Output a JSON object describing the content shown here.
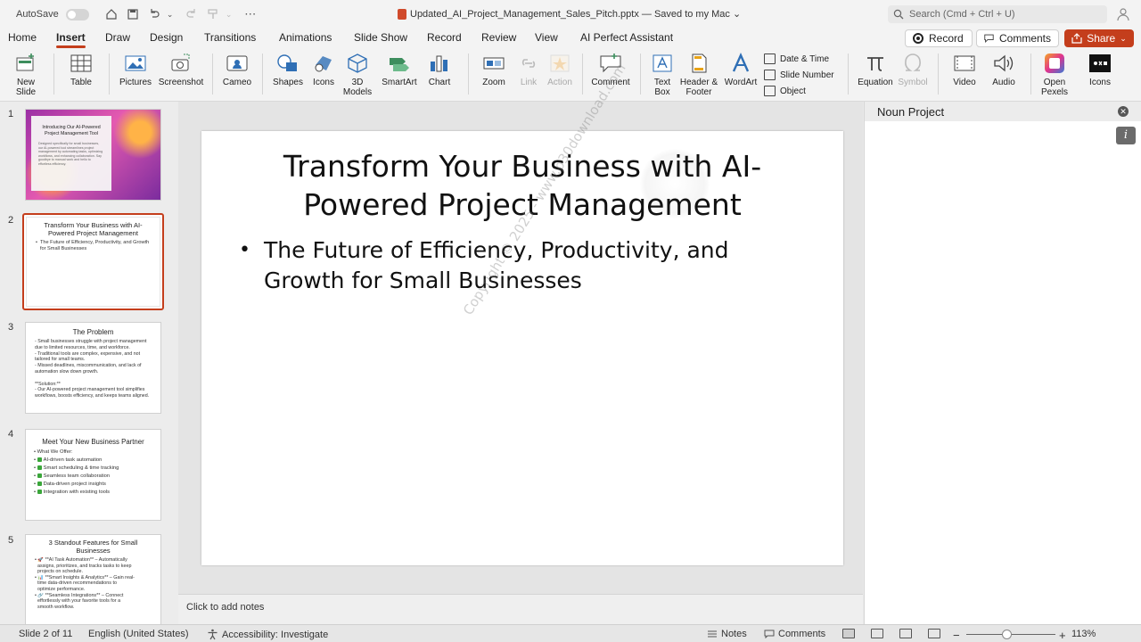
{
  "titlebar": {
    "autosave_label": "AutoSave",
    "doc_title": "Updated_AI_Project_Management_Sales_Pitch.pptx — Saved to my Mac ⌄",
    "search_placeholder": "Search (Cmd + Ctrl + U)"
  },
  "tabs": [
    "Home",
    "Insert",
    "Draw",
    "Design",
    "Transitions",
    "Animations",
    "Slide Show",
    "Record",
    "Review",
    "View",
    "AI Perfect Assistant"
  ],
  "active_tab": "Insert",
  "actions": {
    "record": "Record",
    "comments": "Comments",
    "share": "Share"
  },
  "ribbon": {
    "new_slide": "New\nSlide",
    "table": "Table",
    "pictures": "Pictures",
    "screenshot": "Screenshot",
    "cameo": "Cameo",
    "shapes": "Shapes",
    "icons": "Icons",
    "models_3d": "3D\nModels",
    "smartart": "SmartArt",
    "chart": "Chart",
    "zoom": "Zoom",
    "link": "Link",
    "action": "Action",
    "comment": "Comment",
    "text_box": "Text\nBox",
    "header_footer": "Header &\nFooter",
    "wordart": "WordArt",
    "date_time": "Date & Time",
    "slide_number": "Slide Number",
    "object": "Object",
    "equation": "Equation",
    "symbol": "Symbol",
    "video": "Video",
    "audio": "Audio",
    "open_pexels": "Open\nPexels",
    "icons_addin": "Icons"
  },
  "slides": {
    "numbers": [
      "1",
      "2",
      "3",
      "4",
      "5"
    ],
    "s1": {
      "title": "Introducing Our AI-Powered Project Management Tool",
      "body": "Designed specifically for small businesses, our AI-powered tool streamlines project management by automating tasks, optimizing workflows, and enhancing collaboration. Say goodbye to manual work and hello to effortless efficiency."
    },
    "s2": {
      "title": "Transform Your Business with AI-Powered Project Management",
      "body": [
        "The Future of Efficiency, Productivity, and Growth for Small Businesses"
      ]
    },
    "s3": {
      "title": "The Problem",
      "body": [
        "- Small businesses struggle with project management",
        "due to limited resources, time, and workforce.",
        "- Traditional tools are complex, expensive, and not",
        "tailored for small teams.",
        "- Missed deadlines, miscommunication, and lack of",
        "automation slow down growth.",
        "",
        "**Solution:**",
        "- Our AI-powered project management tool simplifies",
        "workflows, boosts efficiency, and keeps teams aligned."
      ]
    },
    "s4": {
      "title": "Meet Your New Business Partner",
      "intro": "What We Offer:",
      "items": [
        "AI-driven task automation",
        "Smart scheduling & time tracking",
        "Seamless team collaboration",
        "Data-driven project insights",
        "Integration with existing tools"
      ]
    },
    "s5": {
      "title": "3 Standout Features for Small Businesses",
      "body": [
        "🚀 **AI Task Automation** – Automatically",
        "assigns, prioritizes, and tracks tasks to keep",
        "projects on schedule.",
        "📊 **Smart Insights & Analytics** – Gain real-",
        "time data-driven recommendations to",
        "optimize performance.",
        "🔗 **Seamless Integrations** – Connect",
        "effortlessly with your favorite tools for a",
        "smooth workflow."
      ]
    }
  },
  "main_slide": {
    "title_line1": "Transform Your Business with AI-",
    "title_line2": "Powered Project Management",
    "bullet_line1": "The Future of Efficiency, Productivity, and",
    "bullet_line2": "Growth for Small Businesses",
    "watermark": "Copyright © 2025 - www.p30download.com"
  },
  "notes_placeholder": "Click to add notes",
  "pane": {
    "title": "Noun Project"
  },
  "status": {
    "slide_counter": "Slide 2 of 11",
    "language": "English (United States)",
    "accessibility": "Accessibility: Investigate",
    "notes": "Notes",
    "comments": "Comments",
    "zoom": "113%"
  }
}
